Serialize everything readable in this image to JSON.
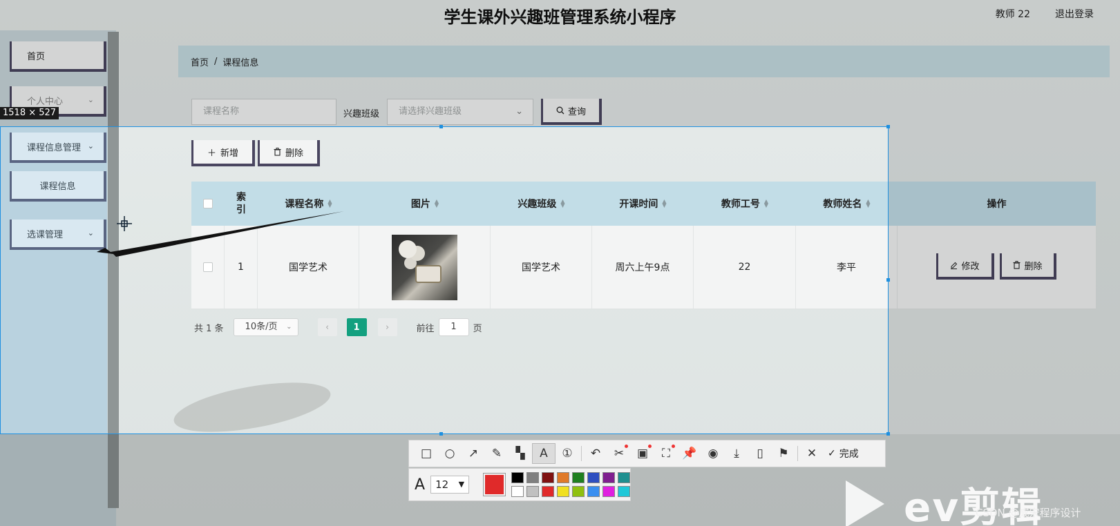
{
  "header": {
    "title": "学生课外兴趣班管理系统小程序",
    "user": "教师 22",
    "logout": "退出登录"
  },
  "sidebar": {
    "items": [
      {
        "label": "首页"
      },
      {
        "label": "个人中心"
      },
      {
        "label": "课程信息管理"
      },
      {
        "label": "课程信息"
      },
      {
        "label": "选课管理"
      }
    ]
  },
  "breadcrumb": {
    "home": "首页",
    "separator": "/",
    "current": "课程信息"
  },
  "search": {
    "name_placeholder": "课程名称",
    "class_label": "兴趣班级",
    "class_placeholder": "请选择兴趣班级",
    "query_label": "查询"
  },
  "actions": {
    "add_label": "新增",
    "delete_label": "删除"
  },
  "table": {
    "columns": [
      "索引",
      "课程名称",
      "图片",
      "兴趣班级",
      "开课时间",
      "教师工号",
      "教师姓名",
      "操作"
    ],
    "rows": [
      {
        "index": "1",
        "course_name": "国学艺术",
        "class_name": "国学艺术",
        "start_time": "周六上午9点",
        "teacher_id": "22",
        "teacher_name": "李平",
        "edit_label": "修改",
        "delete_label": "删除"
      }
    ]
  },
  "pagination": {
    "total": "共 1 条",
    "page_size": "10条/页",
    "current_page": "1",
    "goto_prefix": "前往",
    "goto_value": "1",
    "goto_suffix": "页"
  },
  "capture_tool": {
    "size_label": "1518 × 527",
    "done_label": "完成",
    "font_size": "12",
    "current_color": "#e02a2a",
    "palette": [
      "#000000",
      "#7f7f7f",
      "#7f1010",
      "#e07a2a",
      "#1f7f1f",
      "#2f4fc0",
      "#7f1f8f",
      "#1f8f8f",
      "#ffffff",
      "#c0c0c0",
      "#e02a2a",
      "#f0e020",
      "#8fc010",
      "#3a8ff0",
      "#e020e0",
      "#20c8d8"
    ]
  },
  "watermark": {
    "brand": "ev剪辑",
    "credit": "CSDN @成宋程序设计"
  }
}
